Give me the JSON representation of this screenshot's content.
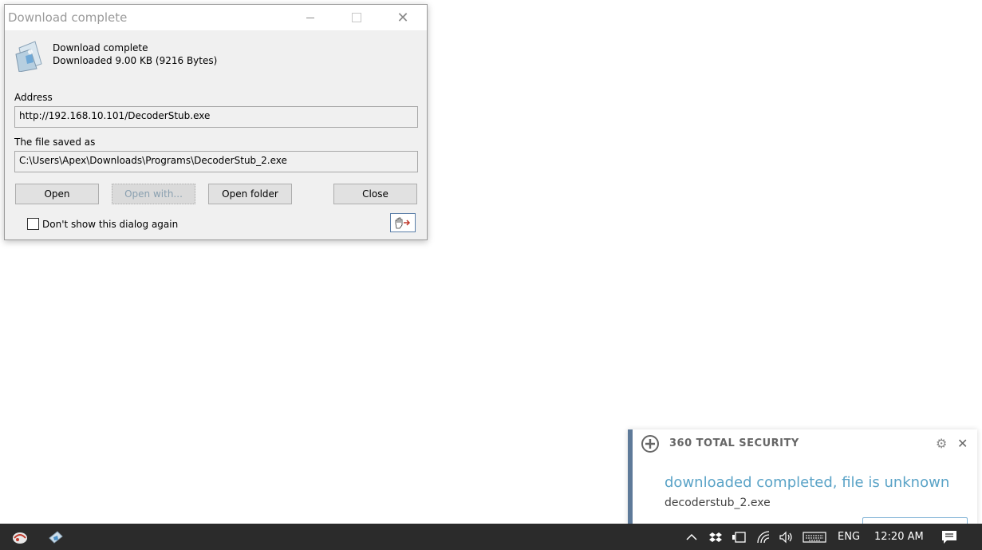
{
  "dialog": {
    "title": "Download complete",
    "heading": "Download complete",
    "size_text": "Downloaded 9.00  KB (9216 Bytes)",
    "address_label": "Address",
    "address_value": "http://192.168.10.101/DecoderStub.exe",
    "saved_label": "The file saved as",
    "saved_value": "C:\\Users\\Apex\\Downloads\\Programs\\DecoderStub_2.exe",
    "buttons": {
      "open": "Open",
      "open_with": "Open with...",
      "open_folder": "Open folder",
      "close": "Close"
    },
    "dont_show_label": "Don't show this dialog again",
    "dont_show_checked": false
  },
  "notification": {
    "brand": "360 TOTAL SECURITY",
    "message": "downloaded completed, file is unknown",
    "filename": "decoderstub_2.exe",
    "accent_color": "#5aa3c7"
  },
  "taskbar": {
    "language": "ENG",
    "time": "12:20 AM",
    "icons": [
      "app-icon-1",
      "app-icon-2",
      "chevron-up-icon",
      "dropbox-icon",
      "tablet-icon",
      "wifi-icon",
      "volume-icon",
      "keyboard-icon",
      "notifications-icon"
    ]
  }
}
